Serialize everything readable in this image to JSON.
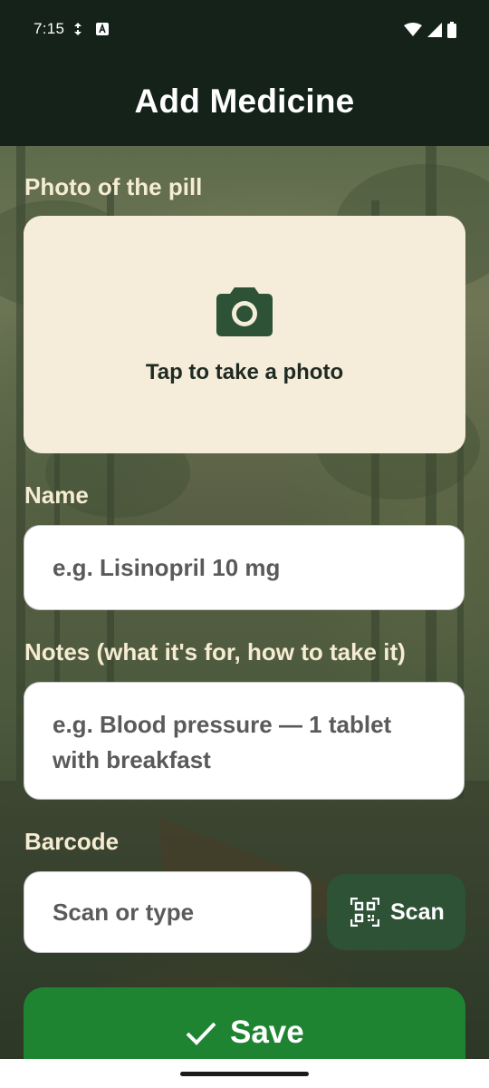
{
  "status_bar": {
    "time": "7:15"
  },
  "app_bar": {
    "title": "Add Medicine"
  },
  "photo": {
    "label": "Photo of the pill",
    "caption": "Tap to take a photo"
  },
  "name": {
    "label": "Name",
    "placeholder": "e.g. Lisinopril 10 mg",
    "value": ""
  },
  "notes": {
    "label": "Notes  (what it's for, how to take it)",
    "placeholder_line1": "e.g. Blood pressure — 1 tablet",
    "placeholder_line2": "with breakfast",
    "value": ""
  },
  "barcode": {
    "label": "Barcode",
    "placeholder": "Scan or type",
    "value": "",
    "scan_label": "Scan"
  },
  "save": {
    "label": "Save"
  },
  "icons": {
    "camera": "camera-icon",
    "scan": "qr-scan-icon",
    "save": "checkmark-icon",
    "wifi": "wifi-icon",
    "signal": "signal-icon",
    "battery": "battery-icon"
  },
  "colors": {
    "app_bar": "#14221a",
    "label_text": "#f5ecd2",
    "photo_box": "#f5edda",
    "camera_icon": "#2d5236",
    "scan_button": "#2d5236",
    "save_button": "#1e8432"
  }
}
